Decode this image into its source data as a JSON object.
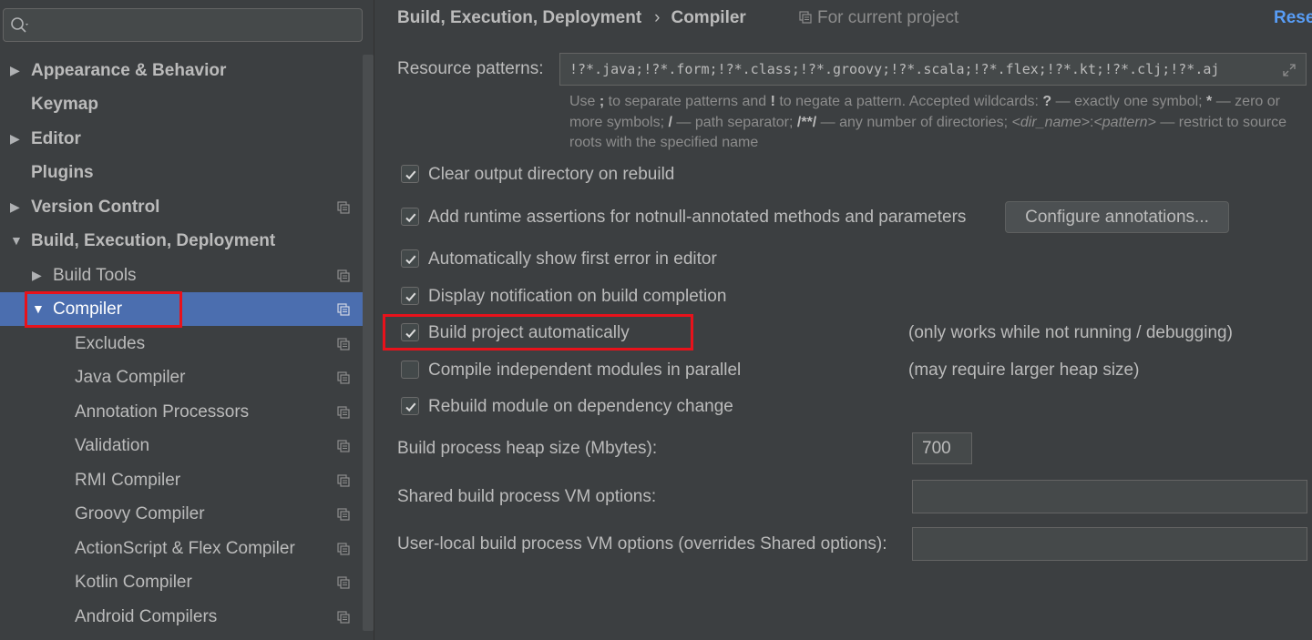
{
  "search": {
    "placeholder": ""
  },
  "sidebar": {
    "items": [
      {
        "label": "Appearance & Behavior",
        "arrow": "▶"
      },
      {
        "label": "Keymap"
      },
      {
        "label": "Editor",
        "arrow": "▶"
      },
      {
        "label": "Plugins"
      },
      {
        "label": "Version Control",
        "arrow": "▶"
      },
      {
        "label": "Build, Execution, Deployment",
        "arrow": "▼"
      },
      {
        "label": "Build Tools",
        "arrow": "▶"
      },
      {
        "label": "Compiler",
        "arrow": "▼"
      },
      {
        "label": "Excludes"
      },
      {
        "label": "Java Compiler"
      },
      {
        "label": "Annotation Processors"
      },
      {
        "label": "Validation"
      },
      {
        "label": "RMI Compiler"
      },
      {
        "label": "Groovy Compiler"
      },
      {
        "label": "ActionScript & Flex Compiler"
      },
      {
        "label": "Kotlin Compiler"
      },
      {
        "label": "Android Compilers"
      }
    ]
  },
  "header": {
    "breadcrumb_parent": "Build, Execution, Deployment",
    "breadcrumb_sep": "›",
    "breadcrumb_current": "Compiler",
    "scope": "For current project",
    "reset": "Reset"
  },
  "resource": {
    "label": "Resource patterns:",
    "value": "!?*.java;!?*.form;!?*.class;!?*.groovy;!?*.scala;!?*.flex;!?*.kt;!?*.clj;!?*.aj"
  },
  "hint": {
    "t1": "Use ",
    "sym1": ";",
    "t2": " to separate patterns and ",
    "sym2": "!",
    "t3": " to negate a pattern. Accepted wildcards: ",
    "sym3": "?",
    "t4": " — exactly one symbol; ",
    "sym4": "*",
    "t5": " — zero or more symbols; ",
    "sym5": "/",
    "t6": " — path separator; ",
    "sym6": "/**/",
    "t7": " — any number of directories; ",
    "it1": "<dir_name>",
    "t8": ":",
    "it2": "<pattern>",
    "t9": " — restrict to source roots with the specified name"
  },
  "options": [
    {
      "label": "Clear output directory on rebuild",
      "checked": true
    },
    {
      "label": "Add runtime assertions for notnull-annotated methods and parameters",
      "checked": true
    },
    {
      "label": "Automatically show first error in editor",
      "checked": true
    },
    {
      "label": "Display notification on build completion",
      "checked": true
    },
    {
      "label": "Build project automatically",
      "checked": true,
      "note": "(only works while not running / debugging)"
    },
    {
      "label": "Compile independent modules in parallel",
      "checked": false,
      "note": "(may require larger heap size)"
    },
    {
      "label": "Rebuild module on dependency change",
      "checked": true
    }
  ],
  "configure_button": "Configure annotations...",
  "heap": {
    "label": "Build process heap size (Mbytes):",
    "value": "700"
  },
  "shared_vm": {
    "label": "Shared build process VM options:",
    "value": ""
  },
  "local_vm": {
    "label": "User-local build process VM options (overrides Shared options):",
    "value": ""
  },
  "colors": {
    "background": "#3c3f41",
    "selection": "#4b6eaf",
    "link": "#589df6",
    "highlight_box": "#e8121b"
  }
}
